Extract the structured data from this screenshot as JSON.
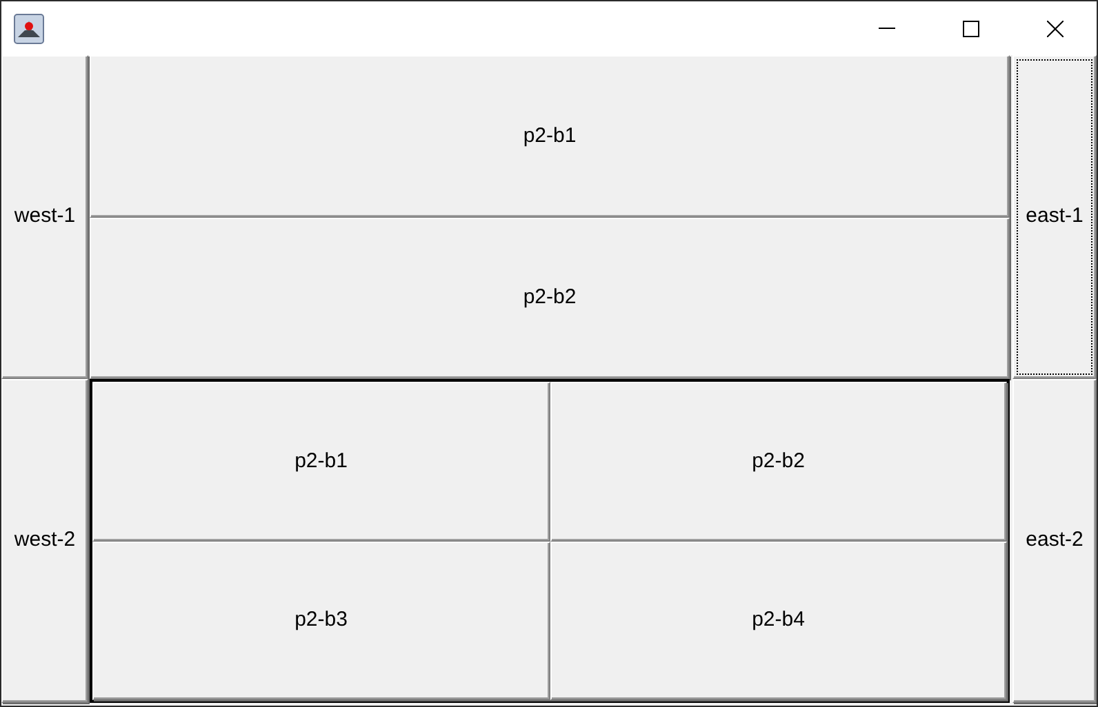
{
  "window": {
    "controls": [
      {
        "kind": "minimize"
      },
      {
        "kind": "maximize"
      },
      {
        "kind": "close"
      }
    ]
  },
  "rows": [
    {
      "west": {
        "label": "west-1",
        "focused": false
      },
      "center": {
        "kind": "stack",
        "buttons": [
          {
            "label": "p2-b1",
            "focused": false
          },
          {
            "label": "p2-b2",
            "focused": false
          }
        ]
      },
      "east": {
        "label": "east-1",
        "focused": true
      }
    },
    {
      "west": {
        "label": "west-2",
        "focused": false
      },
      "center": {
        "kind": "bordered-grid",
        "buttons": [
          {
            "label": "p2-b1",
            "focused": false
          },
          {
            "label": "p2-b2",
            "focused": false
          },
          {
            "label": "p2-b3",
            "focused": false
          },
          {
            "label": "p2-b4",
            "focused": false
          }
        ]
      },
      "east": {
        "label": "east-2",
        "focused": false
      }
    }
  ]
}
